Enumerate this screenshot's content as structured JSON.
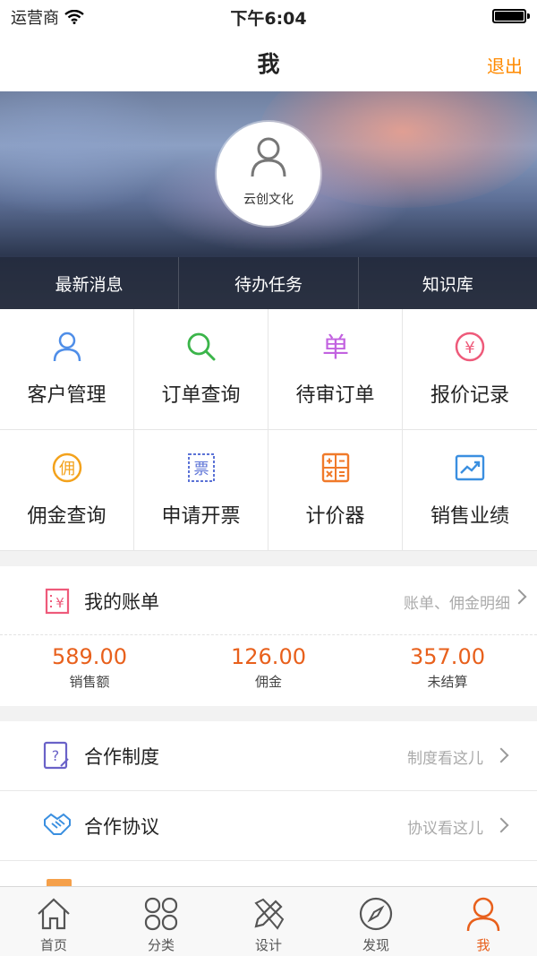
{
  "status_bar": {
    "carrier": "运营商",
    "time": "下午6:04"
  },
  "nav": {
    "title": "我",
    "logout": "退出"
  },
  "profile": {
    "name": "云创文化"
  },
  "hero_tabs": [
    "最新消息",
    "待办任务",
    "知识库"
  ],
  "grid": [
    {
      "label": "客户管理",
      "icon": "user-icon",
      "color": "#4f8ee8"
    },
    {
      "label": "订单查询",
      "icon": "search-icon",
      "color": "#3bb54a"
    },
    {
      "label": "待审订单",
      "icon": "dan-icon",
      "color": "#c262e0"
    },
    {
      "label": "报价记录",
      "icon": "yen-icon",
      "color": "#ee5a7a"
    },
    {
      "label": "佣金查询",
      "icon": "yong-icon",
      "color": "#f3a21c"
    },
    {
      "label": "申请开票",
      "icon": "invoice-icon",
      "color": "#5b72d6"
    },
    {
      "label": "计价器",
      "icon": "calculator-icon",
      "color": "#f07a2a"
    },
    {
      "label": "销售业绩",
      "icon": "trend-chart-icon",
      "color": "#3a8fe0"
    }
  ],
  "bill": {
    "title": "我的账单",
    "link": "账单、佣金明细",
    "stats": [
      {
        "value": "589.00",
        "label": "销售额"
      },
      {
        "value": "126.00",
        "label": "佣金"
      },
      {
        "value": "357.00",
        "label": "未结算"
      }
    ]
  },
  "list": [
    {
      "title": "合作制度",
      "link": "制度看这儿",
      "icon": "document-question-icon"
    },
    {
      "title": "合作协议",
      "link": "协议看这儿",
      "icon": "handshake-icon"
    }
  ],
  "tabbar": [
    {
      "label": "首页",
      "icon": "home-icon"
    },
    {
      "label": "分类",
      "icon": "category-icon"
    },
    {
      "label": "设计",
      "icon": "design-icon"
    },
    {
      "label": "发现",
      "icon": "compass-icon"
    },
    {
      "label": "我",
      "icon": "user-icon",
      "active": true
    }
  ],
  "colors": {
    "accent": "#e8601c",
    "logout": "#ff8a00"
  }
}
